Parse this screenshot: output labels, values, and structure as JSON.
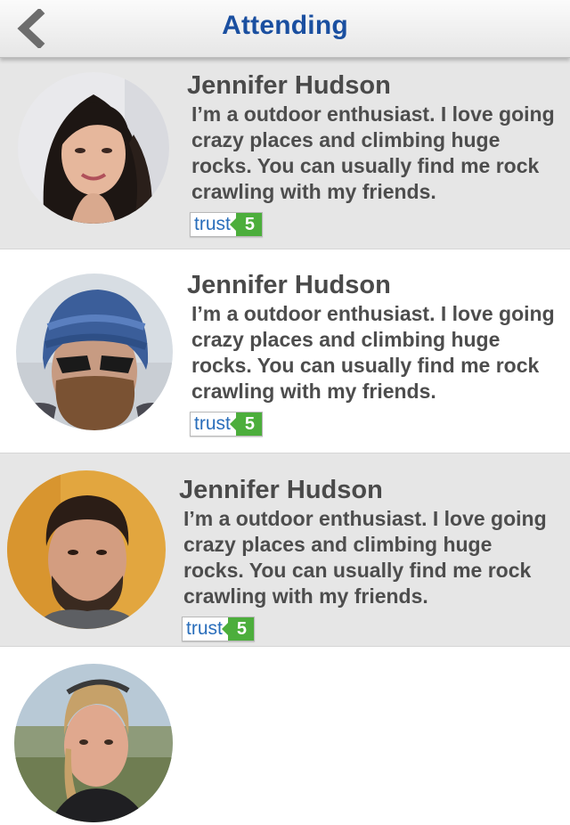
{
  "header": {
    "title": "Attending",
    "back_icon": "chevron-left-icon"
  },
  "attendees": [
    {
      "name": "Jennifer Hudson",
      "bio": "I’m a outdoor enthusiast. I love going crazy places and climbing huge rocks. You can usually find me rock crawling with my friends.",
      "trust_label": "trust",
      "trust_score": "5"
    },
    {
      "name": "Jennifer Hudson",
      "bio": "I’m a outdoor enthusiast. I love going crazy places and climbing huge rocks. You can usually find me rock crawling with my friends.",
      "trust_label": "trust",
      "trust_score": "5"
    },
    {
      "name": "Jennifer Hudson",
      "bio": "I’m a outdoor enthusiast. I love going crazy places and climbing huge rocks. You can usually find me rock crawling with my friends.",
      "trust_label": "trust",
      "trust_score": "5"
    },
    {
      "name": "",
      "bio": "",
      "trust_label": "",
      "trust_score": ""
    }
  ],
  "colors": {
    "title_blue": "#1a4fa0",
    "row_shaded": "#e6e6e6",
    "trust_green": "#4cae3c",
    "trust_blue": "#2a6ebb"
  }
}
